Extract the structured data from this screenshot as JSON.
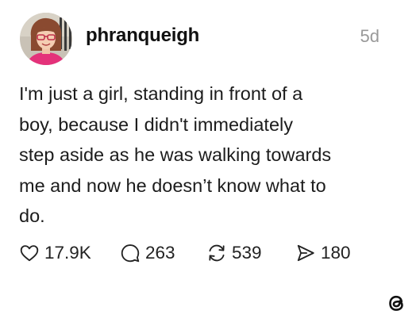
{
  "post": {
    "username": "phranqueigh",
    "timestamp": "5d",
    "text_lines": [
      "I'm just a girl, standing in front of a",
      "boy, because I didn't immediately",
      "step aside as he was walking towards",
      "me and now he doesn’t know what to",
      "do."
    ]
  },
  "actions": {
    "likes": "17.9K",
    "replies": "263",
    "reposts": "539",
    "shares": "180"
  },
  "icons": {
    "like": "heart-icon",
    "reply": "speech-bubble-icon",
    "repost": "repost-icon",
    "share": "send-icon",
    "brand": "threads-logo-icon"
  }
}
